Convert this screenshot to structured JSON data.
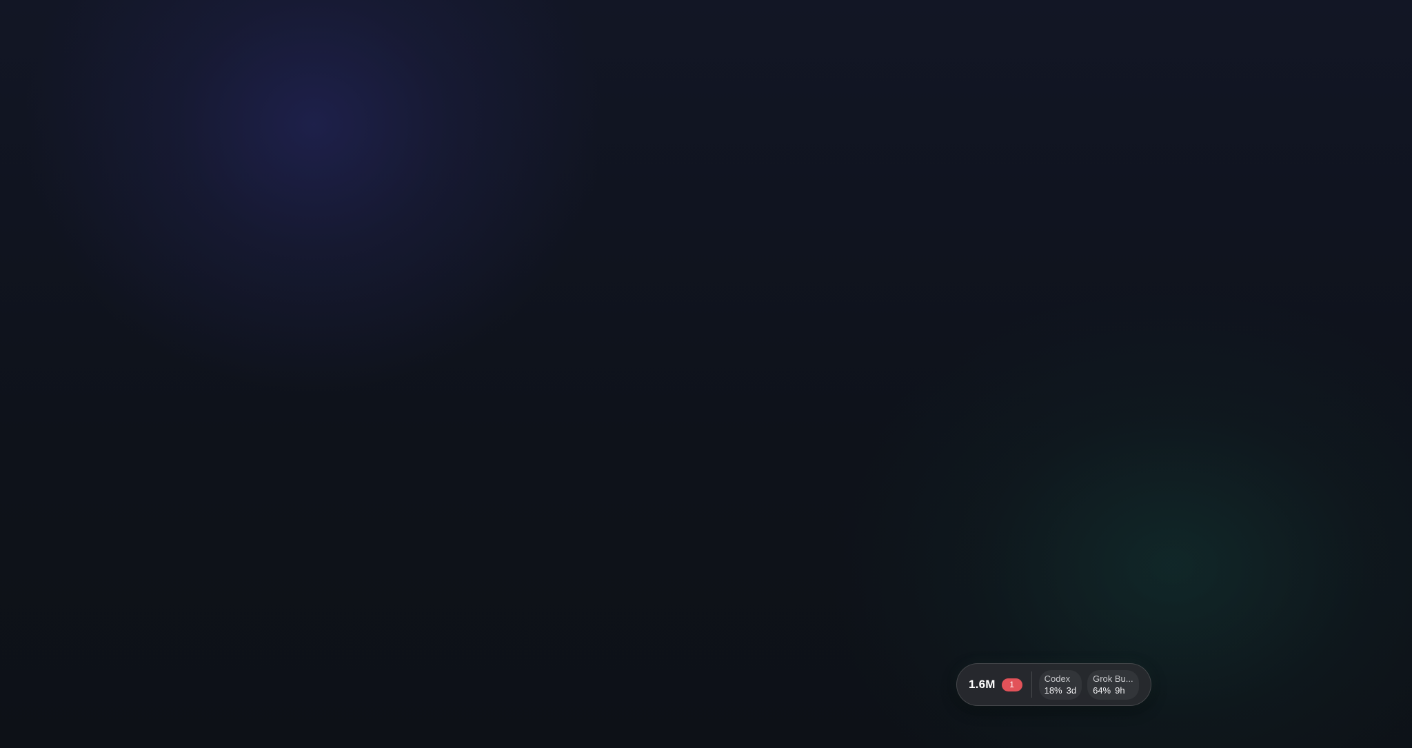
{
  "widget": {
    "total": "1.6M",
    "badge": "1",
    "services": [
      {
        "name": "Codex",
        "percent": "18%",
        "time": "3d"
      },
      {
        "name": "Grok Bu...",
        "percent": "64%",
        "time": "9h"
      }
    ]
  },
  "colors": {
    "badge": "#e25259",
    "pill_background": "#28292e",
    "page_background": "#0f131b"
  }
}
